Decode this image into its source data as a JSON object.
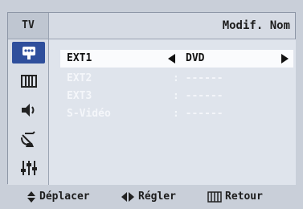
{
  "header": {
    "tab_label": "TV",
    "title": "Modif. Nom"
  },
  "sidebar": {
    "items": [
      {
        "icon": "input-source-icon",
        "active": true
      },
      {
        "icon": "picture-icon",
        "active": false
      },
      {
        "icon": "sound-icon",
        "active": false
      },
      {
        "icon": "channel-antenna-icon",
        "active": false
      },
      {
        "icon": "setup-sliders-icon",
        "active": false
      }
    ]
  },
  "rows": [
    {
      "label": "EXT1",
      "value": "DVD",
      "selected": true
    },
    {
      "label": "EXT2",
      "value": ": ------",
      "selected": false
    },
    {
      "label": "EXT3",
      "value": ": ------",
      "selected": false
    },
    {
      "label": "S-Vidéo",
      "value": ": ------",
      "selected": false
    }
  ],
  "footer": {
    "move_label": "Déplacer",
    "adjust_label": "Régler",
    "return_label": "Retour"
  },
  "colors": {
    "accent": "#2f4f9c",
    "selected_row": "#fafbfd"
  }
}
